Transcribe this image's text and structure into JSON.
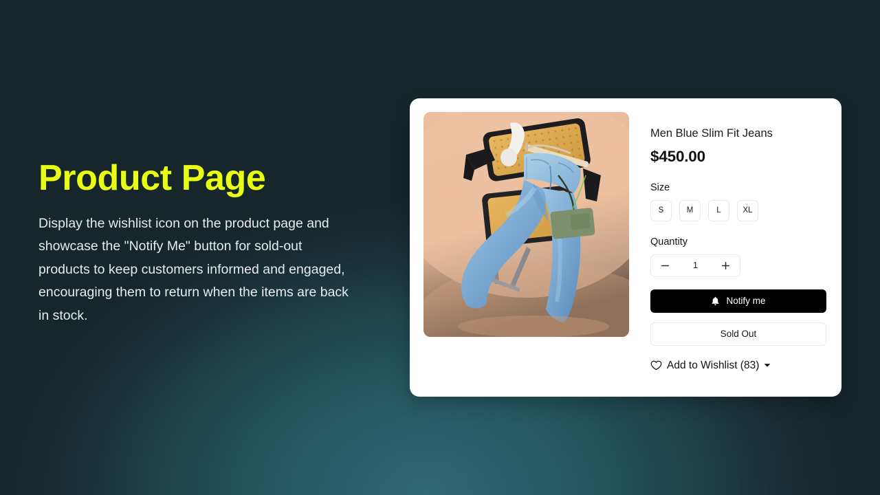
{
  "theme": {
    "background_dark": "#16262b",
    "background_glow": "#2f6775",
    "title_accent": "#e8ff14",
    "card_background": "#ffffff",
    "primary_button": "#000000",
    "border_light": "#e3e9ef"
  },
  "left_panel": {
    "title": "Product Page",
    "description": "Display the wishlist icon on the product page and showcase the \"Notify Me\" button for sold-out products to keep customers informed and engaged, encouraging them to return when the items are back in stock."
  },
  "product_card": {
    "image": {
      "alt": "Blue slim fit jeans on a hanger over a rattan chair with a green crossbody bag",
      "icon_name": "product-photo"
    },
    "title": "Men Blue Slim Fit Jeans",
    "price": "$450.00",
    "size": {
      "label": "Size",
      "options": [
        "S",
        "M",
        "L",
        "XL"
      ]
    },
    "quantity": {
      "label": "Quantity",
      "decrement_label": "—",
      "value": "1",
      "increment_label": "+"
    },
    "notify_button": {
      "label": "Notify me",
      "icon_name": "bell-icon"
    },
    "sold_out_button": {
      "label": "Sold Out"
    },
    "wishlist": {
      "label": "Add to Wishlist (83)",
      "count": 83,
      "heart_icon_name": "heart-outline-icon",
      "caret_icon_name": "chevron-down-icon"
    }
  }
}
